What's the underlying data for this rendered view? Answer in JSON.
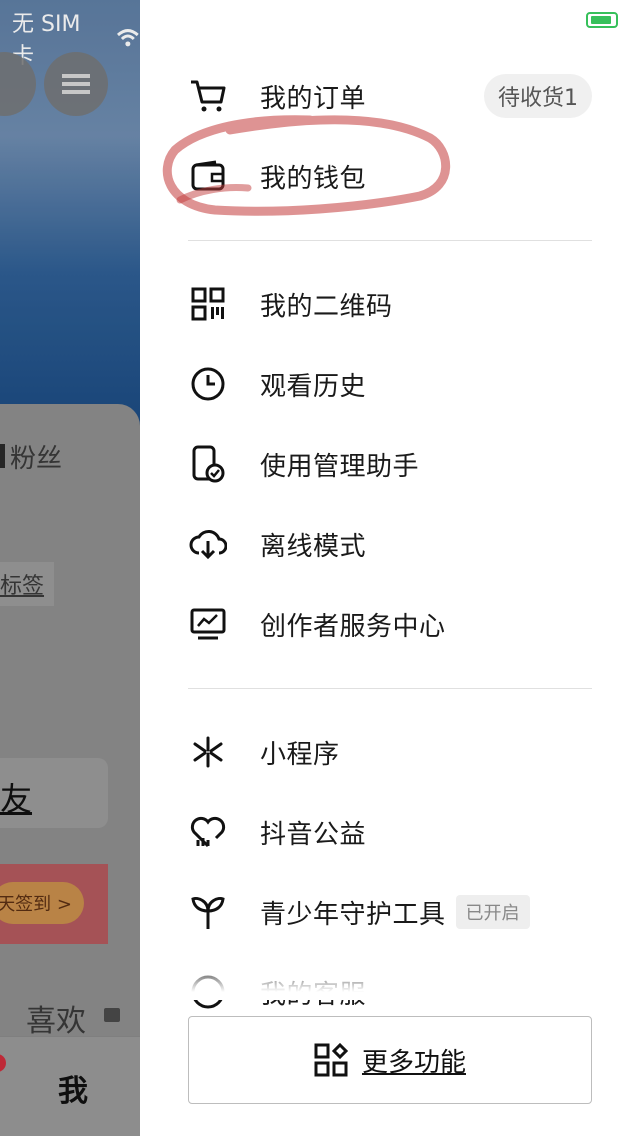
{
  "status_bar": {
    "carrier": "无 SIM 卡"
  },
  "background": {
    "fans_label": "粉丝",
    "tag_label": "标签",
    "friend_label": "友",
    "checkin_label": "天签到 >",
    "likes_label": "喜欢",
    "me_tab": "我"
  },
  "drawer": {
    "orders": {
      "label": "我的订单",
      "badge": "待收货1"
    },
    "wallet": {
      "label": "我的钱包"
    },
    "qrcode": {
      "label": "我的二维码"
    },
    "history": {
      "label": "观看历史"
    },
    "usage": {
      "label": "使用管理助手"
    },
    "offline": {
      "label": "离线模式"
    },
    "creator": {
      "label": "创作者服务中心"
    },
    "miniprogram": {
      "label": "小程序"
    },
    "charity": {
      "label": "抖音公益"
    },
    "youth": {
      "label": "青少年守护工具",
      "badge": "已开启"
    },
    "partial": {
      "label": "我的客服"
    },
    "more": {
      "label": "更多功能"
    }
  },
  "colors": {
    "annotation": "#c23b3b",
    "battery": "#36c05a"
  },
  "icons": [
    "cart-icon",
    "wallet-icon",
    "qrcode-icon",
    "clock-icon",
    "phone-check-icon",
    "cloud-download-icon",
    "monitor-chart-icon",
    "asterisk-icon",
    "heart-hand-icon",
    "sprout-icon",
    "grid-icon",
    "wifi-icon",
    "battery-icon",
    "menu-icon"
  ]
}
